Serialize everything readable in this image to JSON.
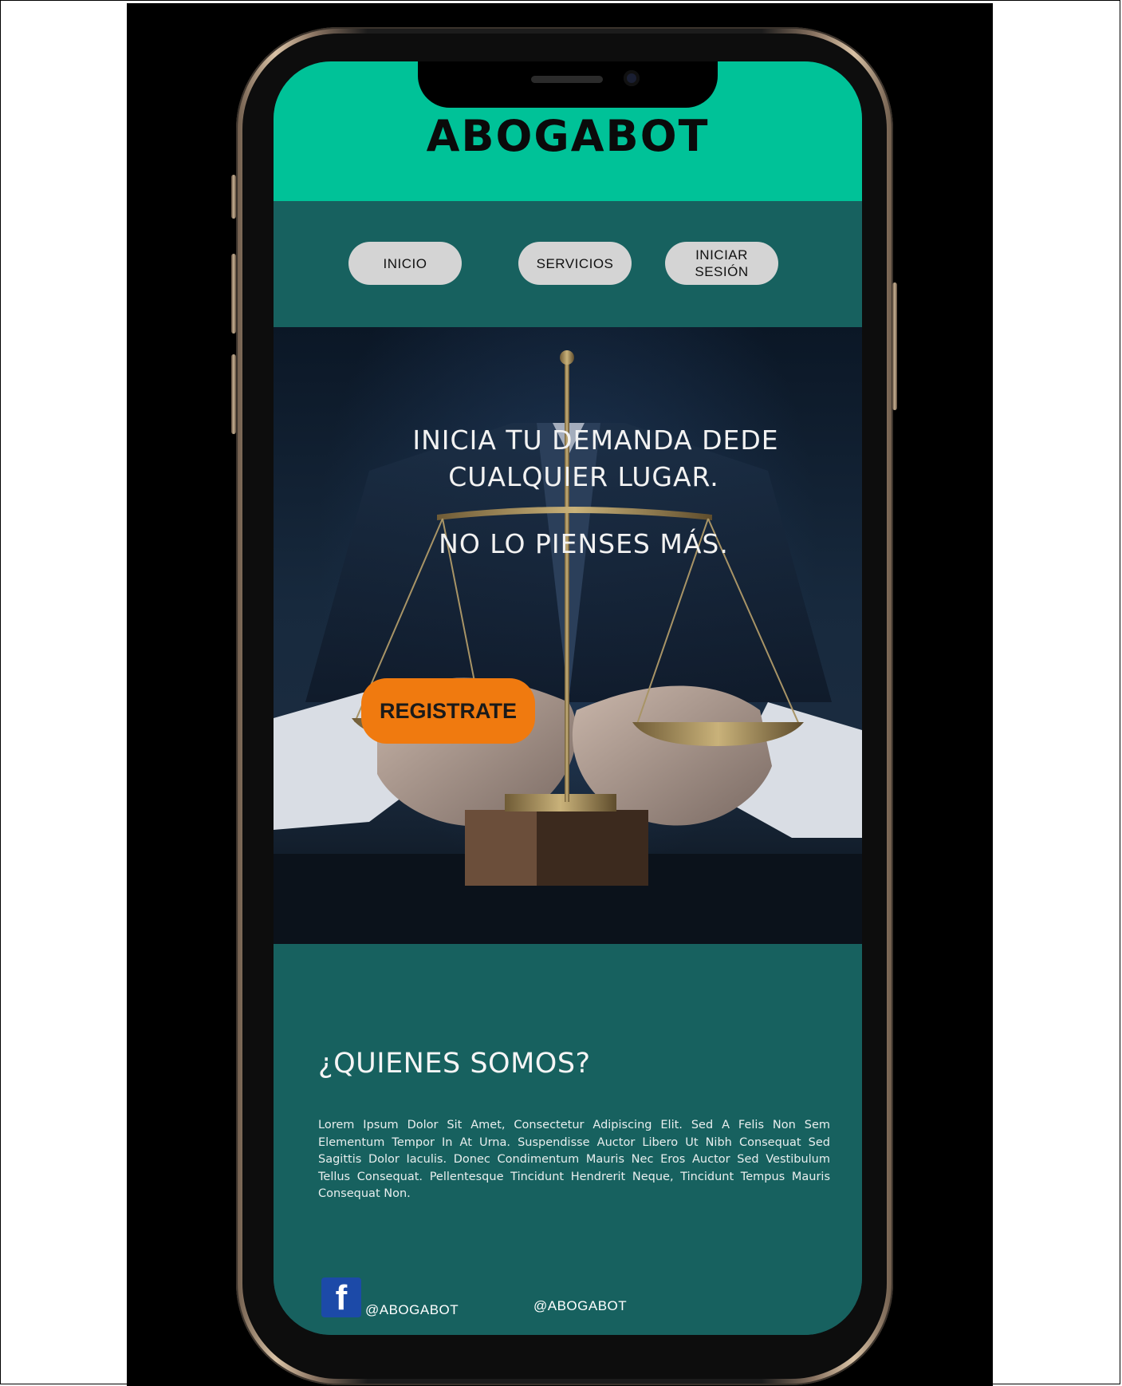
{
  "header": {
    "brand": "ABOGABOT"
  },
  "nav": {
    "inicio": "INICIO",
    "servicios": "SERVICIOS",
    "iniciar_sesion": "INICIAR\nSESIÓN"
  },
  "hero": {
    "line1": "INICIA TU DEMANDA DEDE",
    "line2": "CUALQUIER LUGAR.",
    "line3": "NO LO PIENSES MÁS.",
    "cta": "REGISTRATE"
  },
  "about": {
    "title": "¿QUIENES SOMOS?",
    "body": "Lorem Ipsum Dolor Sit Amet, Consectetur Adipiscing Elit. Sed A Felis Non Sem Elementum Tempor In At Urna. Suspendisse Auctor Libero Ut Nibh Consequat Sed Sagittis Dolor Iaculis. Donec Condimentum Mauris Nec Eros Auctor Sed Vestibulum Tellus Consequat. Pellentesque Tincidunt Hendrerit Neque, Tincidunt Tempus Mauris Consequat Non."
  },
  "footer": {
    "facebook_glyph": "f",
    "facebook_handle": "@ABOGABOT",
    "second_handle": "@ABOGABOT"
  },
  "colors": {
    "header_bg": "#00c298",
    "section_bg": "#17615f",
    "cta_bg": "#f07a0f",
    "pill_bg": "#d4d4d4",
    "facebook_blue": "#1c4aa8"
  },
  "icons": [
    "facebook-icon",
    "scales-of-justice-image"
  ]
}
